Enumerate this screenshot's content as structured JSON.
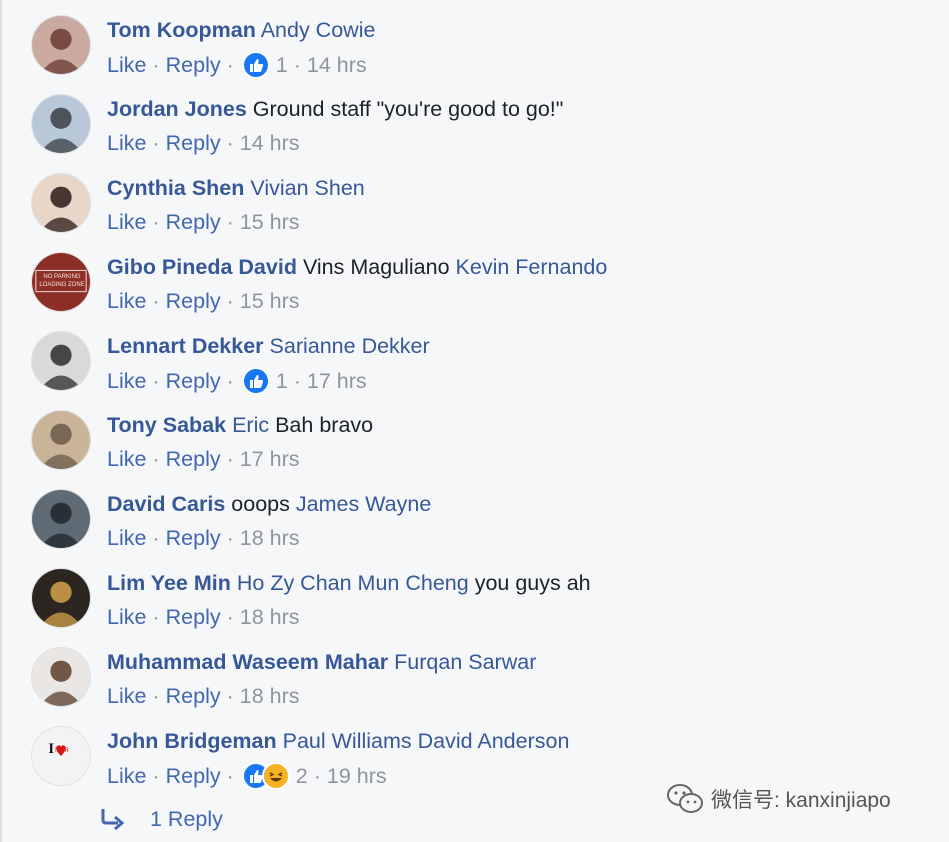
{
  "comments": [
    {
      "author": "Tom Koopman",
      "parts": [
        {
          "t": "Andy Cowie",
          "m": true
        }
      ],
      "like": "Like",
      "reply": "Reply",
      "reactions": [
        "like"
      ],
      "reaction_count": "1",
      "time": "14 hrs"
    },
    {
      "author": "Jordan Jones",
      "parts": [
        {
          "t": "Ground staff \"you're good to go!\"",
          "m": false
        }
      ],
      "like": "Like",
      "reply": "Reply",
      "reactions": [],
      "reaction_count": "",
      "time": "14 hrs"
    },
    {
      "author": "Cynthia Shen",
      "parts": [
        {
          "t": "Vivian Shen",
          "m": true
        }
      ],
      "like": "Like",
      "reply": "Reply",
      "reactions": [],
      "reaction_count": "",
      "time": "15 hrs"
    },
    {
      "author": "Gibo Pineda David",
      "parts": [
        {
          "t": "Vins Maguliano",
          "m": false
        },
        {
          "t": "Kevin Fernando",
          "m": true
        }
      ],
      "like": "Like",
      "reply": "Reply",
      "reactions": [],
      "reaction_count": "",
      "time": "15 hrs"
    },
    {
      "author": "Lennart Dekker",
      "parts": [
        {
          "t": "Sarianne Dekker",
          "m": true
        }
      ],
      "like": "Like",
      "reply": "Reply",
      "reactions": [
        "like"
      ],
      "reaction_count": "1",
      "time": "17 hrs"
    },
    {
      "author": "Tony Sabak",
      "parts": [
        {
          "t": "Eric",
          "m": true
        },
        {
          "t": "Bah bravo",
          "m": false
        }
      ],
      "like": "Like",
      "reply": "Reply",
      "reactions": [],
      "reaction_count": "",
      "time": "17 hrs"
    },
    {
      "author": "David Caris",
      "parts": [
        {
          "t": "ooops",
          "m": false
        },
        {
          "t": "James Wayne",
          "m": true
        }
      ],
      "like": "Like",
      "reply": "Reply",
      "reactions": [],
      "reaction_count": "",
      "time": "18 hrs"
    },
    {
      "author": "Lim Yee Min",
      "parts": [
        {
          "t": "Ho Zy Chan Mun Cheng",
          "m": true
        },
        {
          "t": "you guys ah",
          "m": false
        }
      ],
      "like": "Like",
      "reply": "Reply",
      "reactions": [],
      "reaction_count": "",
      "time": "18 hrs"
    },
    {
      "author": "Muhammad Waseem Mahar",
      "parts": [
        {
          "t": "Furqan Sarwar",
          "m": true
        }
      ],
      "like": "Like",
      "reply": "Reply",
      "reactions": [],
      "reaction_count": "",
      "time": "18 hrs"
    },
    {
      "author": "John Bridgeman",
      "parts": [
        {
          "t": "Paul Williams David Anderson",
          "m": true
        }
      ],
      "like": "Like",
      "reply": "Reply",
      "reactions": [
        "like",
        "haha"
      ],
      "reaction_count": "2",
      "time": "19 hrs"
    }
  ],
  "avatars": [
    {
      "kind": "photo",
      "bg": "#c9a9a0",
      "fg": "#6b3b32",
      "text": ""
    },
    {
      "kind": "photo",
      "bg": "#b9c8d8",
      "fg": "#3a3f46",
      "text": ""
    },
    {
      "kind": "photo",
      "bg": "#e8d6c8",
      "fg": "#2a1a16",
      "text": ""
    },
    {
      "kind": "sign",
      "bg": "#8e2f27",
      "fg": "#f2e6dc",
      "text": "NO PARKING LOADING ZONE"
    },
    {
      "kind": "photo",
      "bg": "#d9d9d9",
      "fg": "#2b2b2b",
      "text": ""
    },
    {
      "kind": "photo",
      "bg": "#c9b49a",
      "fg": "#6a5a48",
      "text": ""
    },
    {
      "kind": "photo",
      "bg": "#5e6b74",
      "fg": "#1f262b",
      "text": ""
    },
    {
      "kind": "photo",
      "bg": "#2b2620",
      "fg": "#d4a24a",
      "text": ""
    },
    {
      "kind": "photo",
      "bg": "#e9e6e3",
      "fg": "#5a3d2b",
      "text": ""
    },
    {
      "kind": "badge",
      "bg": "#f3f3f3",
      "fg": "#d11",
      "text": "MCR"
    }
  ],
  "view_replies": {
    "label": "1 Reply",
    "icon": "reply-arrow-icon"
  },
  "watermark": {
    "text": "微信号: kanxinjiapo",
    "icon": "wechat-icon"
  },
  "colors": {
    "link": "#365899",
    "action": "#4267b2",
    "meta": "#90949c",
    "like_blue": "#1877f2",
    "haha_yellow": "#f7b125"
  }
}
